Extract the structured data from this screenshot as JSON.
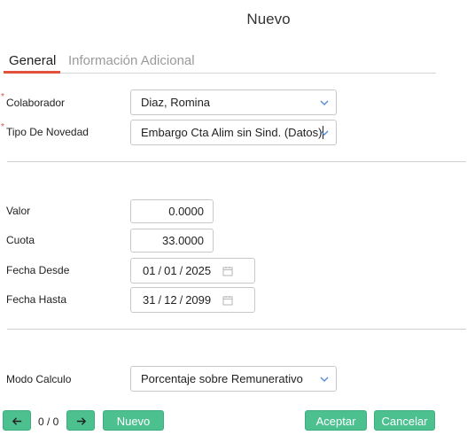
{
  "dialog": {
    "title": "Nuevo"
  },
  "tabs": [
    {
      "label": "General",
      "active": true
    },
    {
      "label": "Información Adicional",
      "active": false
    }
  ],
  "form": {
    "colaborador": {
      "label": "Colaborador",
      "value": "Diaz, Romina",
      "required": "*"
    },
    "tipo_novedad": {
      "label": "Tipo De Novedad",
      "value": "Embargo Cta Alim sin Sind. (Datos)",
      "required": "*"
    },
    "valor": {
      "label": "Valor",
      "value": "0.0000"
    },
    "cuota": {
      "label": "Cuota",
      "value": "33.0000"
    },
    "fecha_desde": {
      "label": "Fecha Desde",
      "day": "01",
      "month": "01",
      "year": "2025"
    },
    "fecha_hasta": {
      "label": "Fecha Hasta",
      "day": "31",
      "month": "12",
      "year": "2099"
    },
    "modo_calculo": {
      "label": "Modo Calculo",
      "value": "Porcentaje sobre Remunerativo"
    }
  },
  "footer": {
    "pager_text": "0 / 0",
    "new_label": "Nuevo",
    "accept_label": "Aceptar",
    "cancel_label": "Cancelar"
  },
  "colors": {
    "accent": "#e0533a",
    "button": "#4cc08f",
    "chevron": "#5b8fd6"
  }
}
